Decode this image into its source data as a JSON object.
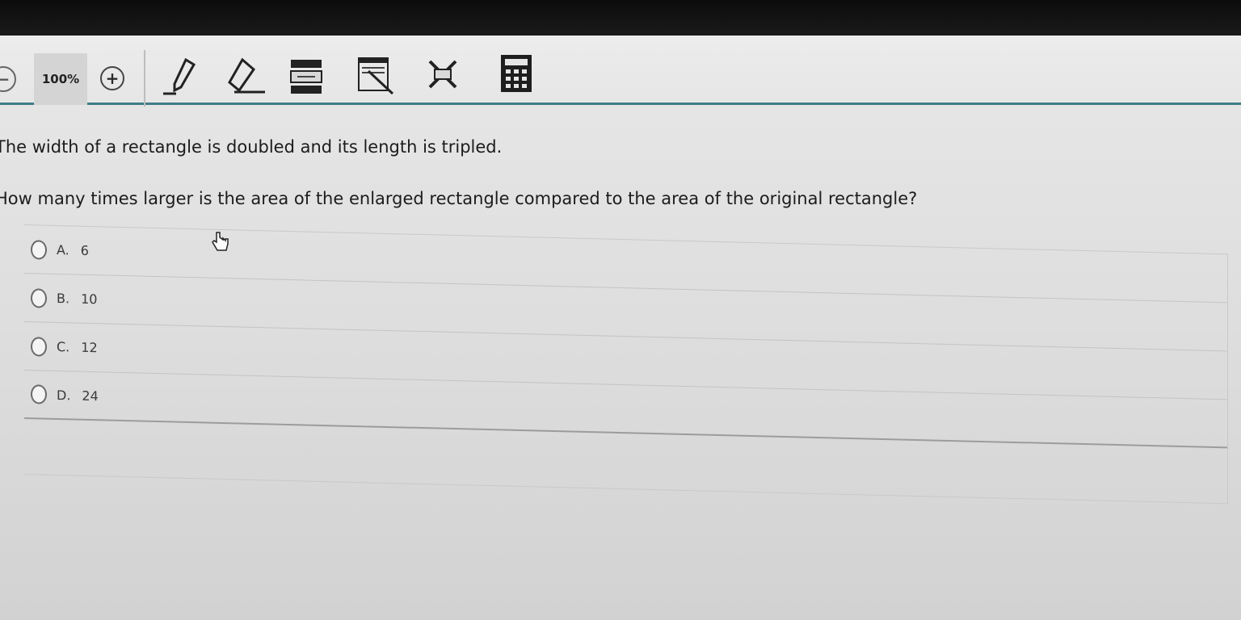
{
  "toolbar": {
    "zoom_level": "100%",
    "zoom_out_glyph": "−",
    "zoom_in_glyph": "+",
    "icons": [
      "zoom-out-icon",
      "zoom-in-icon",
      "pencil-icon",
      "eraser-icon",
      "highlighter-icon",
      "line-reader-icon",
      "answer-eliminator-icon",
      "calculator-icon"
    ],
    "accent_color": "#3f7d86"
  },
  "question": {
    "stem_line1": "The width of a rectangle is doubled and its length is tripled.",
    "stem_line2": "How many times larger is the area of the enlarged rectangle compared to the area of the original rectangle?"
  },
  "choices": [
    {
      "letter": "A.",
      "value": "6"
    },
    {
      "letter": "B.",
      "value": "10"
    },
    {
      "letter": "C.",
      "value": "12"
    },
    {
      "letter": "D.",
      "value": "24"
    }
  ]
}
